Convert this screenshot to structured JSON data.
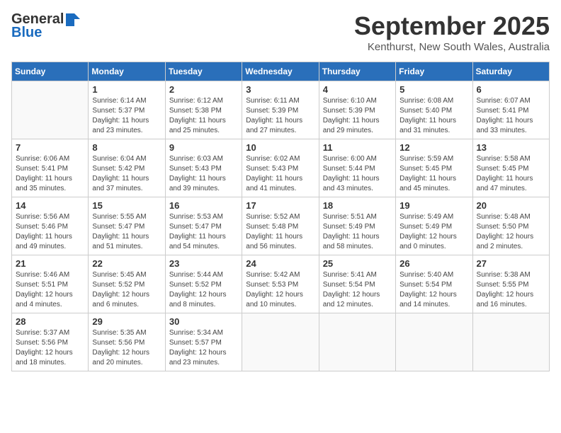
{
  "header": {
    "logo_general": "General",
    "logo_blue": "Blue",
    "month": "September 2025",
    "location": "Kenthurst, New South Wales, Australia"
  },
  "days_of_week": [
    "Sunday",
    "Monday",
    "Tuesday",
    "Wednesday",
    "Thursday",
    "Friday",
    "Saturday"
  ],
  "weeks": [
    [
      {
        "day": "",
        "info": ""
      },
      {
        "day": "1",
        "info": "Sunrise: 6:14 AM\nSunset: 5:37 PM\nDaylight: 11 hours\nand 23 minutes."
      },
      {
        "day": "2",
        "info": "Sunrise: 6:12 AM\nSunset: 5:38 PM\nDaylight: 11 hours\nand 25 minutes."
      },
      {
        "day": "3",
        "info": "Sunrise: 6:11 AM\nSunset: 5:39 PM\nDaylight: 11 hours\nand 27 minutes."
      },
      {
        "day": "4",
        "info": "Sunrise: 6:10 AM\nSunset: 5:39 PM\nDaylight: 11 hours\nand 29 minutes."
      },
      {
        "day": "5",
        "info": "Sunrise: 6:08 AM\nSunset: 5:40 PM\nDaylight: 11 hours\nand 31 minutes."
      },
      {
        "day": "6",
        "info": "Sunrise: 6:07 AM\nSunset: 5:41 PM\nDaylight: 11 hours\nand 33 minutes."
      }
    ],
    [
      {
        "day": "7",
        "info": "Sunrise: 6:06 AM\nSunset: 5:41 PM\nDaylight: 11 hours\nand 35 minutes."
      },
      {
        "day": "8",
        "info": "Sunrise: 6:04 AM\nSunset: 5:42 PM\nDaylight: 11 hours\nand 37 minutes."
      },
      {
        "day": "9",
        "info": "Sunrise: 6:03 AM\nSunset: 5:43 PM\nDaylight: 11 hours\nand 39 minutes."
      },
      {
        "day": "10",
        "info": "Sunrise: 6:02 AM\nSunset: 5:43 PM\nDaylight: 11 hours\nand 41 minutes."
      },
      {
        "day": "11",
        "info": "Sunrise: 6:00 AM\nSunset: 5:44 PM\nDaylight: 11 hours\nand 43 minutes."
      },
      {
        "day": "12",
        "info": "Sunrise: 5:59 AM\nSunset: 5:45 PM\nDaylight: 11 hours\nand 45 minutes."
      },
      {
        "day": "13",
        "info": "Sunrise: 5:58 AM\nSunset: 5:45 PM\nDaylight: 11 hours\nand 47 minutes."
      }
    ],
    [
      {
        "day": "14",
        "info": "Sunrise: 5:56 AM\nSunset: 5:46 PM\nDaylight: 11 hours\nand 49 minutes."
      },
      {
        "day": "15",
        "info": "Sunrise: 5:55 AM\nSunset: 5:47 PM\nDaylight: 11 hours\nand 51 minutes."
      },
      {
        "day": "16",
        "info": "Sunrise: 5:53 AM\nSunset: 5:47 PM\nDaylight: 11 hours\nand 54 minutes."
      },
      {
        "day": "17",
        "info": "Sunrise: 5:52 AM\nSunset: 5:48 PM\nDaylight: 11 hours\nand 56 minutes."
      },
      {
        "day": "18",
        "info": "Sunrise: 5:51 AM\nSunset: 5:49 PM\nDaylight: 11 hours\nand 58 minutes."
      },
      {
        "day": "19",
        "info": "Sunrise: 5:49 AM\nSunset: 5:49 PM\nDaylight: 12 hours\nand 0 minutes."
      },
      {
        "day": "20",
        "info": "Sunrise: 5:48 AM\nSunset: 5:50 PM\nDaylight: 12 hours\nand 2 minutes."
      }
    ],
    [
      {
        "day": "21",
        "info": "Sunrise: 5:46 AM\nSunset: 5:51 PM\nDaylight: 12 hours\nand 4 minutes."
      },
      {
        "day": "22",
        "info": "Sunrise: 5:45 AM\nSunset: 5:52 PM\nDaylight: 12 hours\nand 6 minutes."
      },
      {
        "day": "23",
        "info": "Sunrise: 5:44 AM\nSunset: 5:52 PM\nDaylight: 12 hours\nand 8 minutes."
      },
      {
        "day": "24",
        "info": "Sunrise: 5:42 AM\nSunset: 5:53 PM\nDaylight: 12 hours\nand 10 minutes."
      },
      {
        "day": "25",
        "info": "Sunrise: 5:41 AM\nSunset: 5:54 PM\nDaylight: 12 hours\nand 12 minutes."
      },
      {
        "day": "26",
        "info": "Sunrise: 5:40 AM\nSunset: 5:54 PM\nDaylight: 12 hours\nand 14 minutes."
      },
      {
        "day": "27",
        "info": "Sunrise: 5:38 AM\nSunset: 5:55 PM\nDaylight: 12 hours\nand 16 minutes."
      }
    ],
    [
      {
        "day": "28",
        "info": "Sunrise: 5:37 AM\nSunset: 5:56 PM\nDaylight: 12 hours\nand 18 minutes."
      },
      {
        "day": "29",
        "info": "Sunrise: 5:35 AM\nSunset: 5:56 PM\nDaylight: 12 hours\nand 20 minutes."
      },
      {
        "day": "30",
        "info": "Sunrise: 5:34 AM\nSunset: 5:57 PM\nDaylight: 12 hours\nand 23 minutes."
      },
      {
        "day": "",
        "info": ""
      },
      {
        "day": "",
        "info": ""
      },
      {
        "day": "",
        "info": ""
      },
      {
        "day": "",
        "info": ""
      }
    ]
  ]
}
